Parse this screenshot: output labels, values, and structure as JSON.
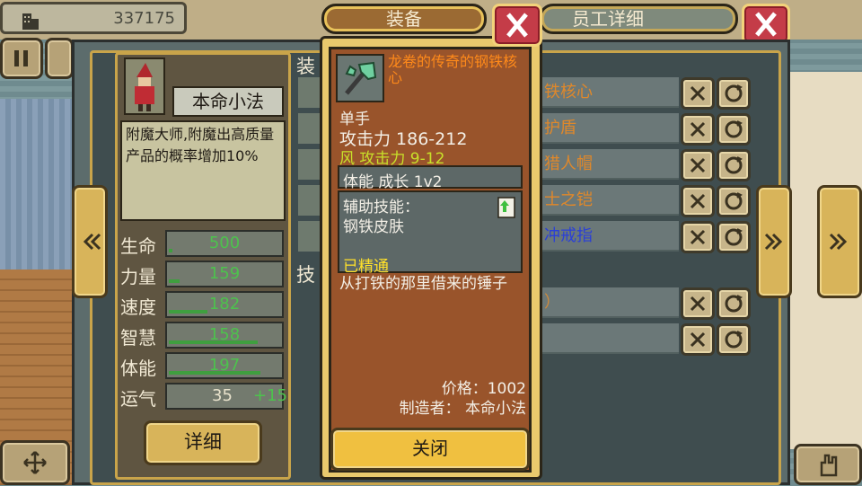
{
  "header": {
    "money": "337175",
    "equip_title": "装备",
    "staff_title": "员工详细"
  },
  "character": {
    "name": "本命小法",
    "trait": "附魔大师,附魔出高质量产品的概率增加10%",
    "detail_button": "详细",
    "stats": [
      {
        "label": "生命",
        "value": "500",
        "fill": 0.03
      },
      {
        "label": "力量",
        "value": "159",
        "fill": 0.1
      },
      {
        "label": "速度",
        "value": "182",
        "fill": 0.35
      },
      {
        "label": "智慧",
        "value": "158",
        "fill": 0.8
      },
      {
        "label": "体能",
        "value": "197",
        "fill": 0.82
      }
    ],
    "luck": {
      "label": "运气",
      "value": "35",
      "bonus": "+15"
    }
  },
  "equipment_section": {
    "header_partial": "装",
    "skill_header_partial": "技",
    "rows": [
      {
        "text": "铁核心",
        "color": "#e0882a"
      },
      {
        "text": "护盾",
        "color": "#e0882a"
      },
      {
        "text": "猎人帽",
        "color": "#e0882a"
      },
      {
        "text": "士之铠",
        "color": "#e0882a"
      },
      {
        "text": "冲戒指",
        "color": "#2a3fd8"
      }
    ],
    "skill_rows": [
      {
        "text": "）",
        "color": "#d08a3a"
      },
      {
        "text": "",
        "color": "#d08a3a"
      }
    ]
  },
  "item": {
    "name": "龙卷的传奇的钢铁核心",
    "type": "单手",
    "attack": "攻击力 186-212",
    "element_attack": "风 攻击力 9-12",
    "growth": "体能 成长 1v2",
    "skill_label": "辅助技能：",
    "skill_name": "钢铁皮肤",
    "mastered": "已精通",
    "description": "从打铁的那里借来的锤子",
    "price": "价格：1002",
    "maker": "制造者： 本命小法",
    "close_button": "关闭"
  },
  "colors": {
    "legendary": "#ff8a1a",
    "element": "#c8e02a",
    "mastered": "#ffe12a",
    "stat_value": "#4dc24d"
  }
}
